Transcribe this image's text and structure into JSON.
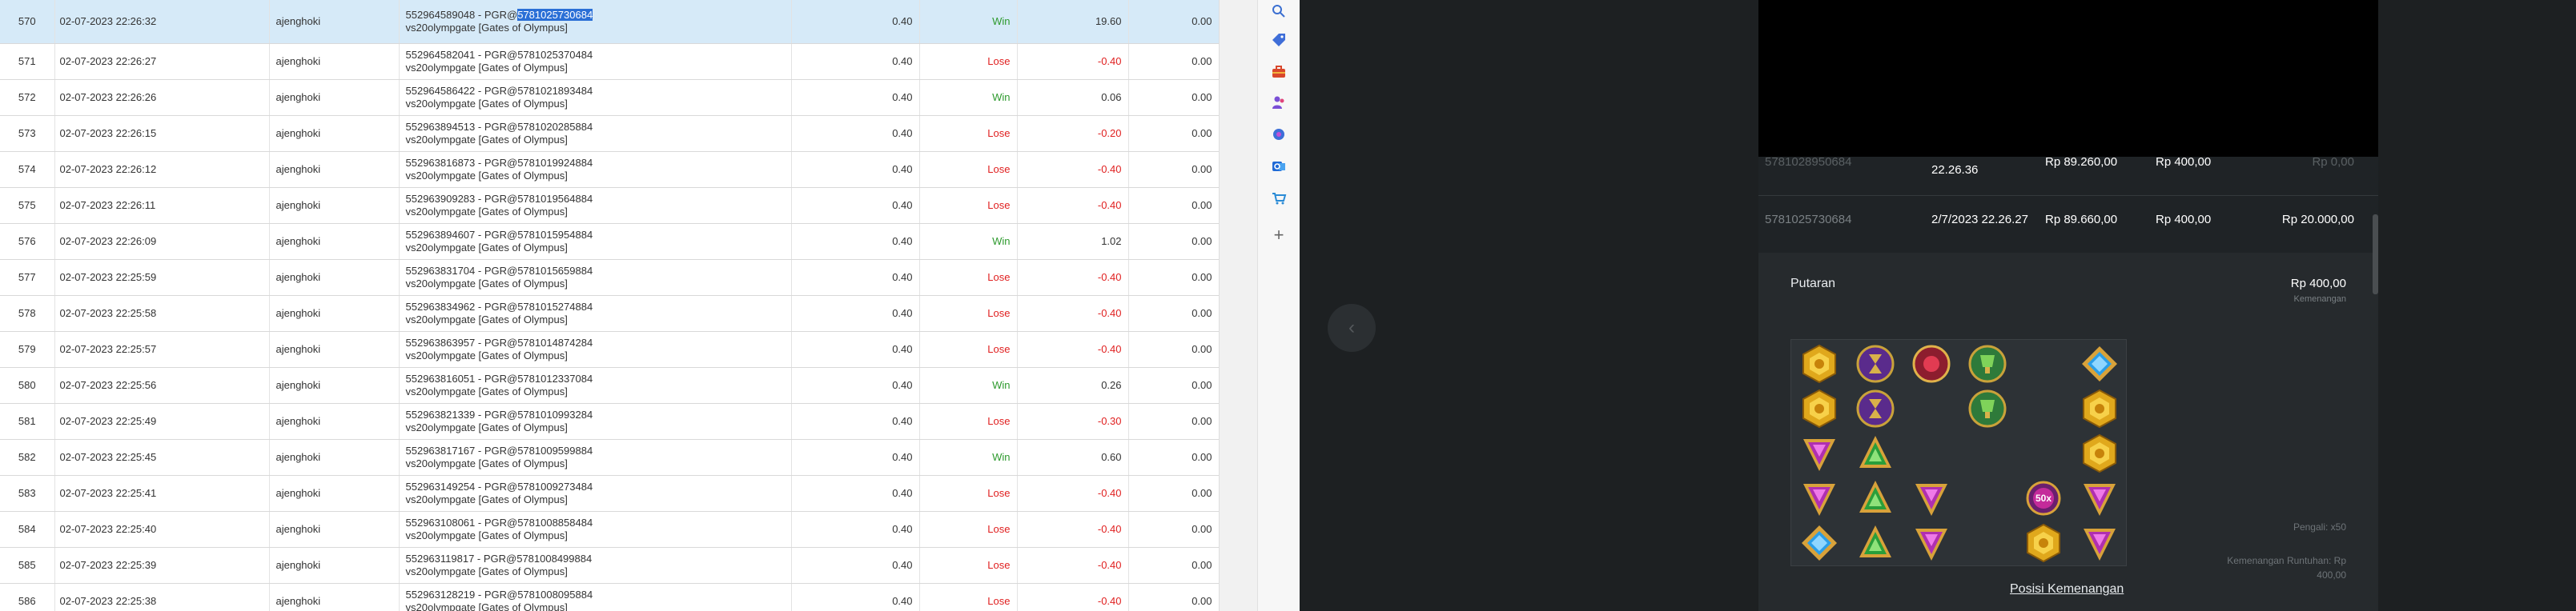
{
  "rows": [
    {
      "no": "570",
      "date": "02-07-2023 22:26:32",
      "user": "ajenghoki",
      "id_prefix": "552964589048 - PGR@",
      "id_ref": "5781025730684",
      "game": "vs20olympgate [Gates of Olympus]",
      "bet": "0.40",
      "result": "Win",
      "win": "19.60",
      "jp": "0.00"
    },
    {
      "no": "571",
      "date": "02-07-2023 22:26:27",
      "user": "ajenghoki",
      "id_prefix": "552964582041 - PGR@",
      "id_ref": "5781025370484",
      "game": "vs20olympgate [Gates of Olympus]",
      "bet": "0.40",
      "result": "Lose",
      "win": "-0.40",
      "jp": "0.00"
    },
    {
      "no": "572",
      "date": "02-07-2023 22:26:26",
      "user": "ajenghoki",
      "id_prefix": "552964586422 - PGR@",
      "id_ref": "5781021893484",
      "game": "vs20olympgate [Gates of Olympus]",
      "bet": "0.40",
      "result": "Win",
      "win": "0.06",
      "jp": "0.00"
    },
    {
      "no": "573",
      "date": "02-07-2023 22:26:15",
      "user": "ajenghoki",
      "id_prefix": "552963894513 - PGR@",
      "id_ref": "5781020285884",
      "game": "vs20olympgate [Gates of Olympus]",
      "bet": "0.40",
      "result": "Lose",
      "win": "-0.20",
      "jp": "0.00"
    },
    {
      "no": "574",
      "date": "02-07-2023 22:26:12",
      "user": "ajenghoki",
      "id_prefix": "552963816873 - PGR@",
      "id_ref": "5781019924884",
      "game": "vs20olympgate [Gates of Olympus]",
      "bet": "0.40",
      "result": "Lose",
      "win": "-0.40",
      "jp": "0.00"
    },
    {
      "no": "575",
      "date": "02-07-2023 22:26:11",
      "user": "ajenghoki",
      "id_prefix": "552963909283 - PGR@",
      "id_ref": "5781019564884",
      "game": "vs20olympgate [Gates of Olympus]",
      "bet": "0.40",
      "result": "Lose",
      "win": "-0.40",
      "jp": "0.00"
    },
    {
      "no": "576",
      "date": "02-07-2023 22:26:09",
      "user": "ajenghoki",
      "id_prefix": "552963894607 - PGR@",
      "id_ref": "5781015954884",
      "game": "vs20olympgate [Gates of Olympus]",
      "bet": "0.40",
      "result": "Win",
      "win": "1.02",
      "jp": "0.00"
    },
    {
      "no": "577",
      "date": "02-07-2023 22:25:59",
      "user": "ajenghoki",
      "id_prefix": "552963831704 - PGR@",
      "id_ref": "5781015659884",
      "game": "vs20olympgate [Gates of Olympus]",
      "bet": "0.40",
      "result": "Lose",
      "win": "-0.40",
      "jp": "0.00"
    },
    {
      "no": "578",
      "date": "02-07-2023 22:25:58",
      "user": "ajenghoki",
      "id_prefix": "552963834962 - PGR@",
      "id_ref": "5781015274884",
      "game": "vs20olympgate [Gates of Olympus]",
      "bet": "0.40",
      "result": "Lose",
      "win": "-0.40",
      "jp": "0.00"
    },
    {
      "no": "579",
      "date": "02-07-2023 22:25:57",
      "user": "ajenghoki",
      "id_prefix": "552963863957 - PGR@",
      "id_ref": "5781014874284",
      "game": "vs20olympgate [Gates of Olympus]",
      "bet": "0.40",
      "result": "Lose",
      "win": "-0.40",
      "jp": "0.00"
    },
    {
      "no": "580",
      "date": "02-07-2023 22:25:56",
      "user": "ajenghoki",
      "id_prefix": "552963816051 - PGR@",
      "id_ref": "5781012337084",
      "game": "vs20olympgate [Gates of Olympus]",
      "bet": "0.40",
      "result": "Win",
      "win": "0.26",
      "jp": "0.00"
    },
    {
      "no": "581",
      "date": "02-07-2023 22:25:49",
      "user": "ajenghoki",
      "id_prefix": "552963821339 - PGR@",
      "id_ref": "5781010993284",
      "game": "vs20olympgate [Gates of Olympus]",
      "bet": "0.40",
      "result": "Lose",
      "win": "-0.30",
      "jp": "0.00"
    },
    {
      "no": "582",
      "date": "02-07-2023 22:25:45",
      "user": "ajenghoki",
      "id_prefix": "552963817167 - PGR@",
      "id_ref": "5781009599884",
      "game": "vs20olympgate [Gates of Olympus]",
      "bet": "0.40",
      "result": "Win",
      "win": "0.60",
      "jp": "0.00"
    },
    {
      "no": "583",
      "date": "02-07-2023 22:25:41",
      "user": "ajenghoki",
      "id_prefix": "552963149254 - PGR@",
      "id_ref": "5781009273484",
      "game": "vs20olympgate [Gates of Olympus]",
      "bet": "0.40",
      "result": "Lose",
      "win": "-0.40",
      "jp": "0.00"
    },
    {
      "no": "584",
      "date": "02-07-2023 22:25:40",
      "user": "ajenghoki",
      "id_prefix": "552963108061 - PGR@",
      "id_ref": "5781008858484",
      "game": "vs20olympgate [Gates of Olympus]",
      "bet": "0.40",
      "result": "Lose",
      "win": "-0.40",
      "jp": "0.00"
    },
    {
      "no": "585",
      "date": "02-07-2023 22:25:39",
      "user": "ajenghoki",
      "id_prefix": "552963119817 - PGR@",
      "id_ref": "5781008499884",
      "game": "vs20olympgate [Gates of Olympus]",
      "bet": "0.40",
      "result": "Lose",
      "win": "-0.40",
      "jp": "0.00"
    },
    {
      "no": "586",
      "date": "02-07-2023 22:25:38",
      "user": "ajenghoki",
      "id_prefix": "552963128219 - PGR@",
      "id_ref": "5781008095884",
      "game": "vs20olympgate [Gates of Olympus]",
      "bet": "0.40",
      "result": "Lose",
      "win": "-0.40",
      "jp": "0.00"
    }
  ],
  "sidebar": {
    "icons": [
      "search-icon",
      "tag-icon",
      "toolbox-icon",
      "users-icon",
      "settings-icon",
      "outlook-icon",
      "cart-icon",
      "plus-icon"
    ]
  },
  "history": [
    {
      "id": "5781028950684",
      "date": "22.26.36",
      "balance": "Rp 89.260,00",
      "bet": "Rp 400,00",
      "win": "Rp 0,00"
    },
    {
      "id": "5781025730684",
      "date": "2/7/2023 22.26.27",
      "balance": "Rp 89.660,00",
      "bet": "Rp 400,00",
      "win": "Rp 20.000,00"
    }
  ],
  "panel": {
    "title": "Putaran",
    "amount": "Rp 400,00",
    "amount_label": "Kemenangan",
    "multiplier_label": "Pengali: x50",
    "cascade_label": "Kemenangan Runtuhan: Rp",
    "cascade_value": "400,00",
    "link": "Posisi Kemenangan",
    "multiplier_orb": "50x"
  },
  "colors": {
    "win": "#2e9a2e",
    "lose": "#e02020",
    "selected_row": "#d6eaf8",
    "highlight": "#2a6fd6",
    "dark_bg": "#1d2022"
  },
  "reels": [
    [
      "gold-crown",
      "purple-hourglass",
      "red-ring",
      "green-cup",
      "",
      "blue-gem"
    ],
    [
      "gold-crown",
      "purple-hourglass",
      "",
      "green-cup",
      "",
      "gold-crown"
    ],
    [
      "purple-triangle",
      "green-triangle",
      "",
      "",
      "",
      "gold-crown"
    ],
    [
      "purple-triangle",
      "green-triangle",
      "purple-triangle",
      "",
      "multiplier-orb",
      "purple-triangle"
    ],
    [
      "blue-gem",
      "green-triangle",
      "purple-triangle",
      "",
      "gold-crown",
      "purple-triangle"
    ]
  ]
}
